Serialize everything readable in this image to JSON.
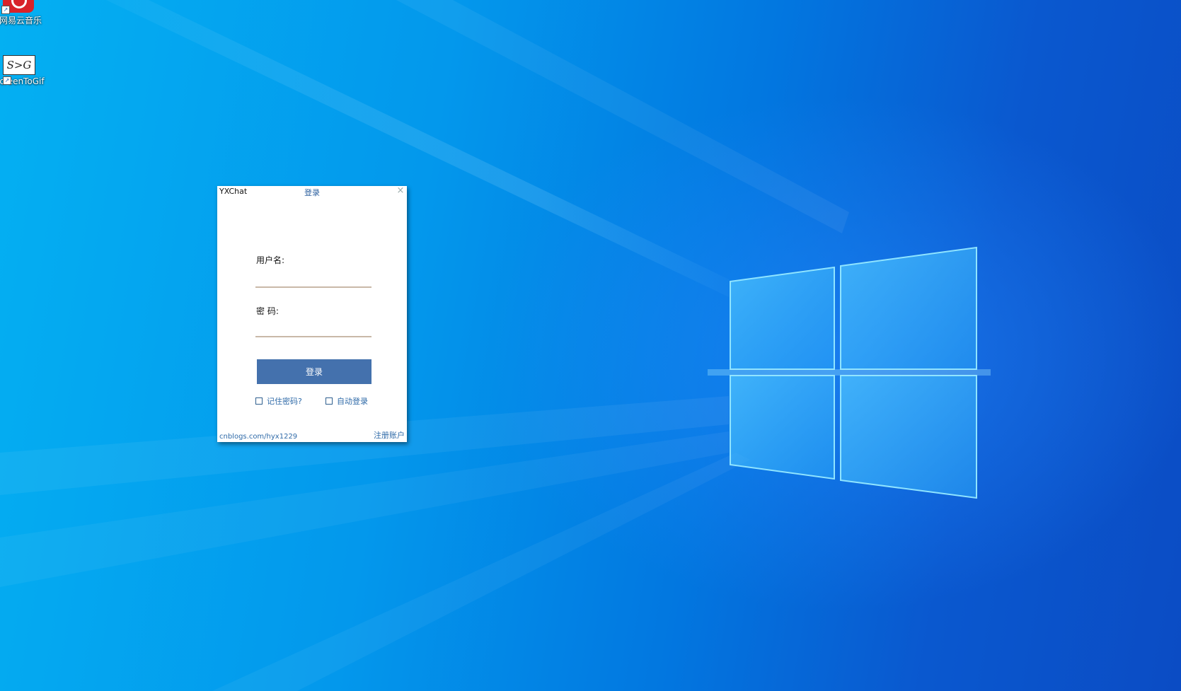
{
  "desktop": {
    "icons": [
      {
        "label": "网易云音乐",
        "icon": "netease-music-icon"
      },
      {
        "label": "creenToGif",
        "glyph": "S>G",
        "icon": "screentogif-icon"
      }
    ],
    "colors": {
      "background_light": "#04b0f2",
      "background_dark": "#0b4cc4"
    }
  },
  "login_window": {
    "app_name": "YXChat",
    "title": "登录",
    "close_symbol": "×",
    "username_label": "用户名:",
    "username_value": "",
    "password_label": "密 码:",
    "password_value": "",
    "login_button_label": "登录",
    "remember_label": "记住密码?",
    "remember_checked": false,
    "autologin_label": "自动登录",
    "autologin_checked": false,
    "footer_link": "cnblogs.com/hyx1229",
    "register_label": "注册账户",
    "colors": {
      "button": "#4471ad",
      "link": "#2f6aa8",
      "input_underline": "#c9b8a8"
    }
  }
}
